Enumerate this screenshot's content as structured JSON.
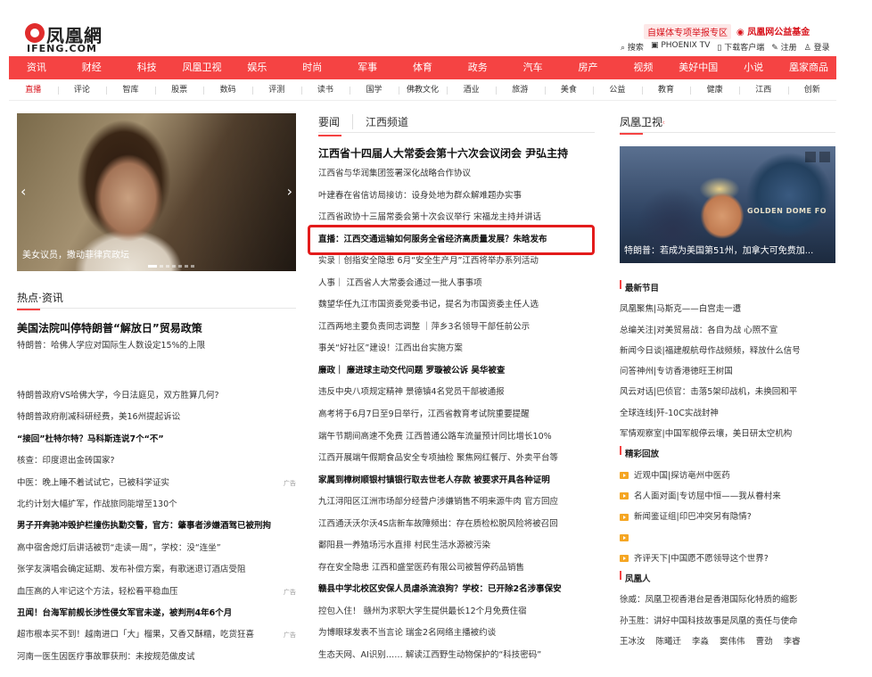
{
  "header": {
    "logo_cn": "凤凰網",
    "logo_en": "IFENG.COM",
    "promo1": "自媒体专项举报专区",
    "promo2": "凤凰网公益基金",
    "toplinks": [
      "搜索",
      "PHOENIX TV",
      "下载客户端",
      "注册",
      "登录"
    ]
  },
  "nav_primary": [
    "资讯",
    "财经",
    "科技",
    "凤凰卫视",
    "娱乐",
    "时尚",
    "军事",
    "体育",
    "政务",
    "汽车",
    "房产",
    "视频",
    "美好中国",
    "小说",
    "凰家商品"
  ],
  "nav_secondary": [
    "直播",
    "评论",
    "智库",
    "股票",
    "数码",
    "评测",
    "读书",
    "国学",
    "佛教文化",
    "酒业",
    "旅游",
    "美食",
    "公益",
    "教育",
    "健康",
    "江西",
    "创新"
  ],
  "slider": {
    "caption": "美女议员，撒动菲律宾政坛",
    "prev": "‹",
    "next": "›"
  },
  "hot": {
    "title": "热点·资讯",
    "headline": "美国法院叫停特朗普“解放日”贸易政策",
    "items1": [
      "特朗普：哈佛人学应对国际生人数设定15%的上限"
    ],
    "items2": [
      "特朗普政府VS哈佛大学，今日法庭见，双方胜算几何?",
      "特朗普政府削减科研经费，美16州提起诉讼",
      "“接回”杜特尔特？马科斯连说7个“不”",
      "核查：印度退出金砖国家?",
      "中医：晚上睡不着试试它，已被科学证实",
      "北约计划大幅扩军，作战旅同能增至130个",
      "男子开奔驰冲毁护栏撞伤执勤交警，官方：肇事者涉嫌酒驾已被刑拘",
      "高中宿舍熄灯后讲话被罚“走读一周”，学校：没“连坐”",
      "张学友演唱会确定延期、发布补偿方案，有歌迷退订酒店受阻",
      "血压高的人牢记这个方法，轻松看平稳血压",
      "丑闻！台海军前舰长涉性侵女军官未遂，被判刑4年6个月",
      "超市根本买不到！越南进口「大」榴果，又香又酥糯，吃货狂喜",
      "河南一医生因医疗事故罪获刑：未按规范做皮试"
    ],
    "ad_label": "广告"
  },
  "mid": {
    "tab1": "要闻",
    "tab2": "江西频道",
    "headline": "江西省十四届人大常委会第十六次会议闭会 尹弘主持",
    "items": [
      "江西省与华润集团签署深化战略合作协议",
      "叶建春在省信访局接访：设身处地为群众解难题办实事",
      "江西省政协十三届常委会第十次会议举行 宋福龙主持并讲话",
      "直播：江西交通运输如何服务全省经济高质量发展？朱晗发布",
      "实录｜创指安全隐患 6月“安全生产月”江西将举办系列活动",
      "人事｜ 江西省人大常委会通过一批人事事项",
      "魏望华任九江市国资委党委书记，提名为市国资委主任人选",
      "江西两地主要负责同志调整 ｜萍乡3名领导干部任前公示",
      "事关“好社区”建设！江西出台实施方案",
      "廉政｜ 廉进球主动交代问题 罗璇被公诉 吴华被查",
      "违反中央八项规定精神 景德镇4名党员干部被通报",
      "高考将于6月7日至9日举行，江西省教育考试院重要提醒",
      "端午节期间高速不免费 江西普通公路车流量预计同比增长10%",
      "江西开展端午假期食品安全专项抽检 聚焦网红餐厅、外卖平台等",
      "家属到樟树顺银村镇银行取去世老人存款 被要求开具各种证明",
      "九江浔阳区江洲市场部分经营户涉嫌销售不明来源牛肉 官方回应",
      "江西通沃沃尔沃4S店新车故障频出：存在质检松脱风险将被召回",
      "鄱阳县一养殖场污水直排 村民生活水源被污染",
      "存在安全隐患 江西和盛堂医药有限公司被暂停药品销售",
      "赣县中学北校区安保人员虐杀流浪狗？学校：已开除2名涉事保安",
      "控包入住！ 赣州为求职大学生提供最长12个月免费住宿",
      "为博眼球发表不当言论 瑞金2名网络主播被约谈",
      "生态天网、AI识别…… 解读江西野生动物保护的“科技密码”"
    ],
    "bold_indices": [
      9,
      14,
      19
    ]
  },
  "right": {
    "title": "凤凰卫视",
    "image_caption": "特朗普：若成为美国第51州，加拿大可免费加...",
    "image_text": "GOLDEN DOME FO",
    "sub1": "最新节目",
    "items1": [
      "凤凰聚焦|马斯克——白宫走一遭",
      "总编关注|对美贸易战：各自为战 心照不宣",
      "新闻今日谈|福建舰航母作战频频，释放什么信号",
      "问答神州|专访香港徳旺王树国",
      "风云对话|巴侦官：击落5架印战机，未换回和平",
      "全球连线|歼-10C实战封神",
      "军情观察室|中国军舰停云壤，美日研太空机构"
    ],
    "sub2": "精彩回放",
    "items2": [
      "近观中国|探访亳州中医药",
      "名人面对面|专访屈中恒——我从眷村来",
      "新闻鉴证组|印巴冲突另有隐情?",
      "",
      "齐评天下|中国愿不愿领导这个世界?"
    ],
    "sub3": "凤凰人",
    "items3": [
      "徐威：凤凰卫视香港台是香港国际化特质的缩影",
      "孙玉胜：讲好中国科技故事是凤凰的责任与使命"
    ],
    "names": [
      "王冰汝",
      "陈曦迁",
      "李淼",
      "窦伟伟",
      "曹劲",
      "李睿"
    ]
  },
  "colors": {
    "brand_red": "#f54343",
    "highlight_red": "#e31b1b",
    "play_orange": "#f5a623"
  }
}
